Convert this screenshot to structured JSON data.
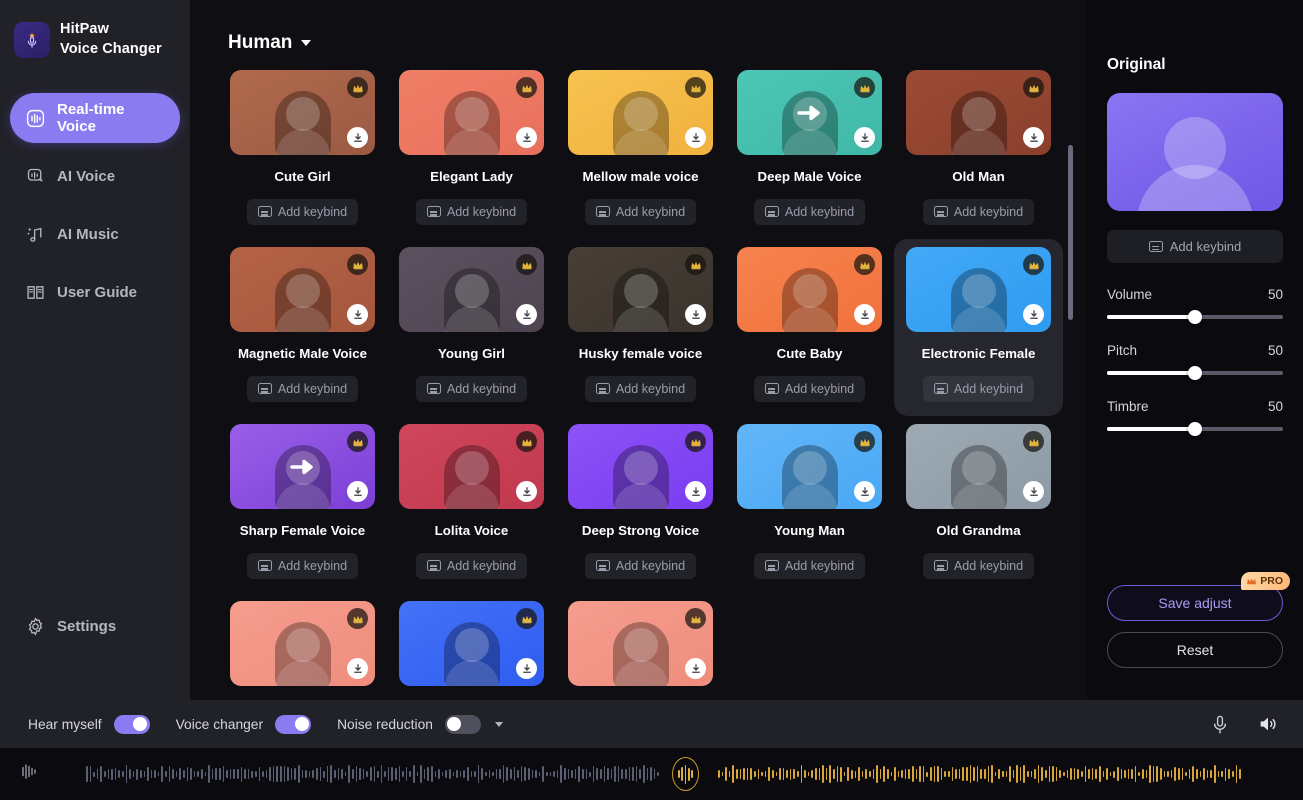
{
  "app": {
    "brand_line1": "HitPaw",
    "brand_line2": "Voice Changer",
    "logo_icon": "microphone-sparkle-icon",
    "accent": "#8b7bf0",
    "crown_color": "#e0ae3c"
  },
  "titlebar": {
    "buttons": [
      {
        "name": "cart-icon",
        "glyph": "cart"
      },
      {
        "name": "account-icon",
        "glyph": "person"
      },
      {
        "name": "menu-icon",
        "glyph": "menu"
      },
      {
        "name": "minimize-icon",
        "glyph": "minimize"
      },
      {
        "name": "close-icon",
        "glyph": "close"
      }
    ]
  },
  "sidebar": {
    "items": [
      {
        "label": "Real-time Voice",
        "icon": "waveform-square-icon",
        "active": true
      },
      {
        "label": "AI Voice",
        "icon": "ai-voice-icon",
        "active": false
      },
      {
        "label": "AI Music",
        "icon": "music-note-sparkle-icon",
        "active": false
      },
      {
        "label": "User Guide",
        "icon": "book-icon",
        "active": false
      }
    ],
    "settings": {
      "label": "Settings",
      "icon": "gear-icon"
    }
  },
  "main": {
    "category": "Human",
    "category_caret": "chevron-down-icon",
    "keybind_label": "Add keybind",
    "cards": [
      {
        "name": "Cute Girl",
        "bg": "#9c5a44",
        "bg2": "#b06a4c",
        "pro": true,
        "download": true,
        "selected": false,
        "arrow": false
      },
      {
        "name": "Elegant Lady",
        "bg": "#e8705c",
        "bg2": "#f07f67",
        "pro": true,
        "download": true,
        "selected": false,
        "arrow": false
      },
      {
        "name": "Mellow male voice",
        "bg": "#f0b13f",
        "bg2": "#f7c24f",
        "pro": true,
        "download": true,
        "selected": false,
        "arrow": false
      },
      {
        "name": "Deep Male Voice",
        "bg": "#3fb8a8",
        "bg2": "#4ec6b6",
        "pro": true,
        "download": true,
        "selected": false,
        "arrow": true
      },
      {
        "name": "Old Man",
        "bg": "#8a3f2c",
        "bg2": "#9c4b35",
        "pro": true,
        "download": true,
        "selected": false,
        "arrow": false
      },
      {
        "name": "Magnetic Male Voice",
        "bg": "#a4563c",
        "bg2": "#b56347",
        "pro": true,
        "download": true,
        "selected": false,
        "arrow": false
      },
      {
        "name": "Young Girl",
        "bg": "#4e4450",
        "bg2": "#5d5160",
        "pro": true,
        "download": true,
        "selected": false,
        "arrow": false
      },
      {
        "name": "Husky female voice",
        "bg": "#3a332c",
        "bg2": "#483f36",
        "pro": true,
        "download": true,
        "selected": false,
        "arrow": false
      },
      {
        "name": "Cute Baby",
        "bg": "#f0713c",
        "bg2": "#f7834e",
        "pro": true,
        "download": true,
        "selected": false,
        "arrow": false
      },
      {
        "name": "Electronic Female",
        "bg": "#2f9bf0",
        "bg2": "#42a9f7",
        "pro": true,
        "download": true,
        "selected": true,
        "arrow": false
      },
      {
        "name": "Sharp Female Voice",
        "bg": "#7b3fd6",
        "bg2": "#9a5fe8",
        "pro": true,
        "download": true,
        "selected": false,
        "arrow": true
      },
      {
        "name": "Lolita Voice",
        "bg": "#c0384e",
        "bg2": "#d0475c",
        "pro": true,
        "download": true,
        "selected": false,
        "arrow": false
      },
      {
        "name": "Deep Strong Voice",
        "bg": "#7a3cf0",
        "bg2": "#8d52f7",
        "pro": true,
        "download": true,
        "selected": false,
        "arrow": false
      },
      {
        "name": "Young Man",
        "bg": "#4aa8f5",
        "bg2": "#62b6f8",
        "pro": true,
        "download": true,
        "selected": false,
        "arrow": false
      },
      {
        "name": "Old Grandma",
        "bg": "#8d9aa4",
        "bg2": "#9daab4",
        "pro": true,
        "download": true,
        "selected": false,
        "arrow": false
      },
      {
        "name": "",
        "bg": "#ef8d7d",
        "bg2": "#f59d8e",
        "pro": true,
        "download": true,
        "selected": false,
        "arrow": false
      },
      {
        "name": "",
        "bg": "#2f5cf0",
        "bg2": "#4472f7",
        "pro": true,
        "download": true,
        "selected": false,
        "arrow": false
      },
      {
        "name": "",
        "bg": "#ef8d7d",
        "bg2": "#f59d8e",
        "pro": true,
        "download": true,
        "selected": false,
        "arrow": false
      }
    ]
  },
  "right_panel": {
    "title": "Original",
    "preview_icon": "avatar-placeholder-icon",
    "keybind_label": "Add keybind",
    "sliders": [
      {
        "label": "Volume",
        "value": "50",
        "percent": 50
      },
      {
        "label": "Pitch",
        "value": "50",
        "percent": 50
      },
      {
        "label": "Timbre",
        "value": "50",
        "percent": 50
      }
    ],
    "save_label": "Save adjust",
    "pro_label": "PRO",
    "reset_label": "Reset"
  },
  "bottom_bar": {
    "toggles": [
      {
        "label": "Hear myself",
        "on": true
      },
      {
        "label": "Voice changer",
        "on": true
      },
      {
        "label": "Noise reduction",
        "on": false
      }
    ],
    "icons": [
      {
        "name": "microphone-icon"
      },
      {
        "name": "speaker-icon"
      }
    ]
  },
  "waveform": {
    "input_icon": "input-level-icon",
    "center_icon": "audio-meter-icon"
  }
}
